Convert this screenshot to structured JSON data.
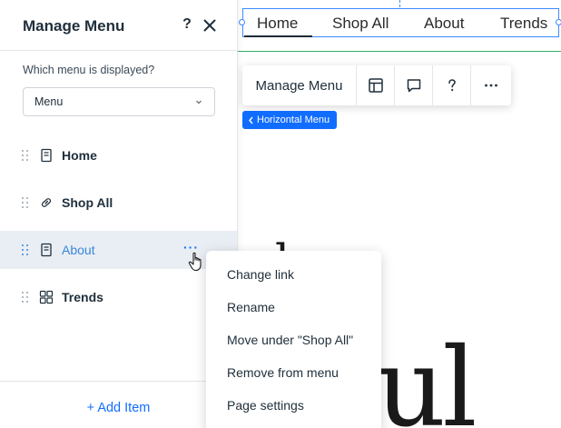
{
  "canvas": {
    "horizontal_menu": {
      "items": [
        "Home",
        "Shop All",
        "About",
        "Trends"
      ],
      "active_item": "Home"
    },
    "floating_toolbar": {
      "label": "Manage Menu",
      "buttons": [
        "layout-icon",
        "comment-icon",
        "help-icon",
        "more-icon"
      ]
    },
    "element_tag": {
      "label": "Horizontal Menu",
      "icon": "chevron-left-icon"
    },
    "page_text_fragments": [
      "l",
      "ul"
    ]
  },
  "panel": {
    "title": "Manage Menu",
    "help_label": "?",
    "select_label": "Which menu is displayed?",
    "select_value": "Menu",
    "items": [
      {
        "label": "Home",
        "icon": "page-icon"
      },
      {
        "label": "Shop All",
        "icon": "link-icon"
      },
      {
        "label": "About",
        "icon": "page-icon",
        "selected": true,
        "more_label": "···"
      },
      {
        "label": "Trends",
        "icon": "dynamic-page-icon"
      }
    ],
    "add_item_label": "+ Add Item"
  },
  "context_menu": {
    "items": [
      "Change link",
      "Rename",
      "Move under \"Shop All\"",
      "Remove from menu",
      "Page settings"
    ]
  },
  "colors": {
    "accent": "#116dff",
    "selection_bg": "#e9eef4",
    "selected_text": "#3a86d9",
    "guide_green": "#2fb06b"
  }
}
